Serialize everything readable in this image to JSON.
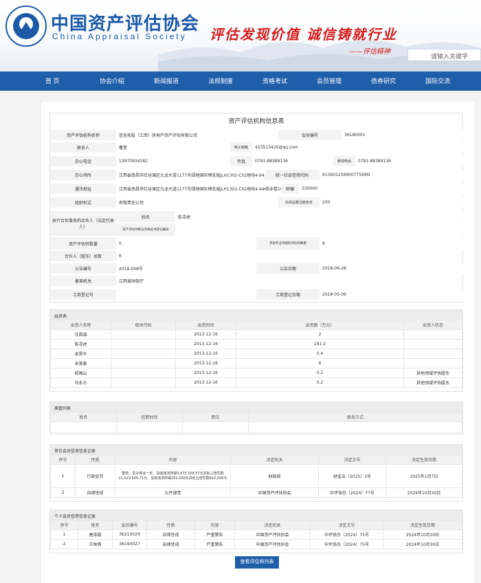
{
  "header": {
    "cn_title": "中国资产评估协会",
    "en_title": "China Appraisal Society",
    "logo_text": "中国资产评估协会 China Appraisal Society",
    "slogan": "评估发现价值 诚信铸就行业",
    "spirit": "——评估精神",
    "search_placeholder": "请输入关键字"
  },
  "nav": [
    "首 页",
    "协会介绍",
    "新闻报道",
    "法规制度",
    "资格考试",
    "会员管理",
    "债券研究",
    "国际交流"
  ],
  "info": {
    "title": "资产评估机构信息表",
    "name_label": "资产评估机构名称",
    "name": "佳信拓投（江西）房地产资产评估有限公司",
    "member_no_label": "会员编号",
    "member_no": "36180001",
    "contact_label": "联系人",
    "contact": "曹星",
    "email_label": "电子邮箱",
    "email": "423513420@qq.com",
    "phone_label": "办公电话",
    "phone": "13970934182",
    "fax_label": "传真",
    "fax": "0791-88389136",
    "mobile_label": "移动电话",
    "mobile": "0791-88389136",
    "office_label": "办公场所",
    "office": "江西省南昌市红谷滩区九龙大道1177号绿地国际博览城JLH1302-C02地块4-94",
    "credit_label": "统一社会信用代码",
    "credit": "91360125690077566N",
    "address_label": "通讯地址",
    "address": "江西省南昌市红谷滩区九龙大道1177号绿地国际博览城JLH1302-C02地块4-9#商业楼101室",
    "postcode_label": "邮编",
    "postcode": "330000",
    "org_label": "组织形式",
    "org": "有限责任公司",
    "capital_label": "出资总额注册资本",
    "capital": "200",
    "partner_label": "执行合伙事务的合伙人（法定代表人）",
    "rep_name_label": "姓名",
    "rep_name": "陈寻虎",
    "rep_cert_label": "资产评估师职业资格证书登记编号",
    "rep_cert": "",
    "appraiser_label": "资产评估师数量",
    "appraiser": "0",
    "other_label": "其他专业领域的评估师数量",
    "other": "8",
    "partners_label": "合伙人（股东）总数",
    "partners": "6",
    "notice_no_label": "公告编号",
    "notice_no": "2018-008号",
    "notice_date_label": "公告日期",
    "notice_date": "2018-06-28",
    "record_org_label": "备案机关",
    "record_org": "江西省财政厅",
    "biz_reg_label": "工商登记号",
    "biz_reg": "",
    "biz_date_label": "工商登记日期",
    "biz_date": "2018-05-09"
  },
  "investors": {
    "title": "出资表",
    "headers": [
      "出资人名称",
      "相关代码",
      "出资时间",
      "出资额（万元）",
      "出资人状态"
    ],
    "rows": [
      [
        "甘昌福",
        "",
        "2013-12-16",
        "2",
        ""
      ],
      [
        "陈寻虎",
        "",
        "2013-12-16",
        "191.2",
        ""
      ],
      [
        "吴晋华",
        "",
        "2013-12-16",
        "0.4",
        ""
      ],
      [
        "吴美善",
        "",
        "2013-12-16",
        "6",
        ""
      ],
      [
        "郝国山",
        "",
        "2013-12-16",
        "0.2",
        "其他领域评估股东"
      ],
      [
        "马永古",
        "",
        "2013-12-16",
        "0.2",
        "其他领域评估股东"
      ]
    ]
  },
  "senior": {
    "title": "高管列表",
    "headers": [
      "姓名",
      "任职时间",
      "职位",
      "联系方式"
    ]
  },
  "unit_credit": {
    "title": "单位会员信用信息记录",
    "headers": [
      "序号",
      "性质",
      "内容",
      "决定机关",
      "决定文号",
      "决定生效日期"
    ],
    "rows": [
      [
        "1",
        "行政处罚",
        "警告、责令停业一年、没收违法所得3,673,168.57元并处三倍罚款11,019,505.71元、没收违法所得162,000元并处五倍罚款810,000元",
        "财政部",
        "财监法〔2025〕1号",
        "2025年1月7日"
      ],
      [
        "2",
        "自律惩戒",
        "公开谴责",
        "中国资产评估协会",
        "中评协办〔2024〕77号",
        "2024年10月30日"
      ]
    ]
  },
  "person_credit": {
    "title": "个人会员信用信息记录",
    "headers": [
      "序号",
      "姓名",
      "会员编号",
      "性质",
      "内容",
      "决定机关",
      "决定文号",
      "决定生效日期"
    ],
    "rows": [
      [
        "1",
        "唐泽璇",
        "36210029",
        "自律惩戒",
        "严重警告",
        "中国资产评估协会",
        "中评协办〔2024〕75号",
        "2024年10月30日"
      ],
      [
        "2",
        "王林燕",
        "36190027",
        "自律惩戒",
        "严重警告",
        "中国资产评估协会",
        "中评协办〔2024〕75号",
        "2024年10月30日"
      ]
    ]
  },
  "button": "查看评估师列表",
  "colors": {
    "brand": "#1f5ea8",
    "slogan": "#d61d1d"
  }
}
